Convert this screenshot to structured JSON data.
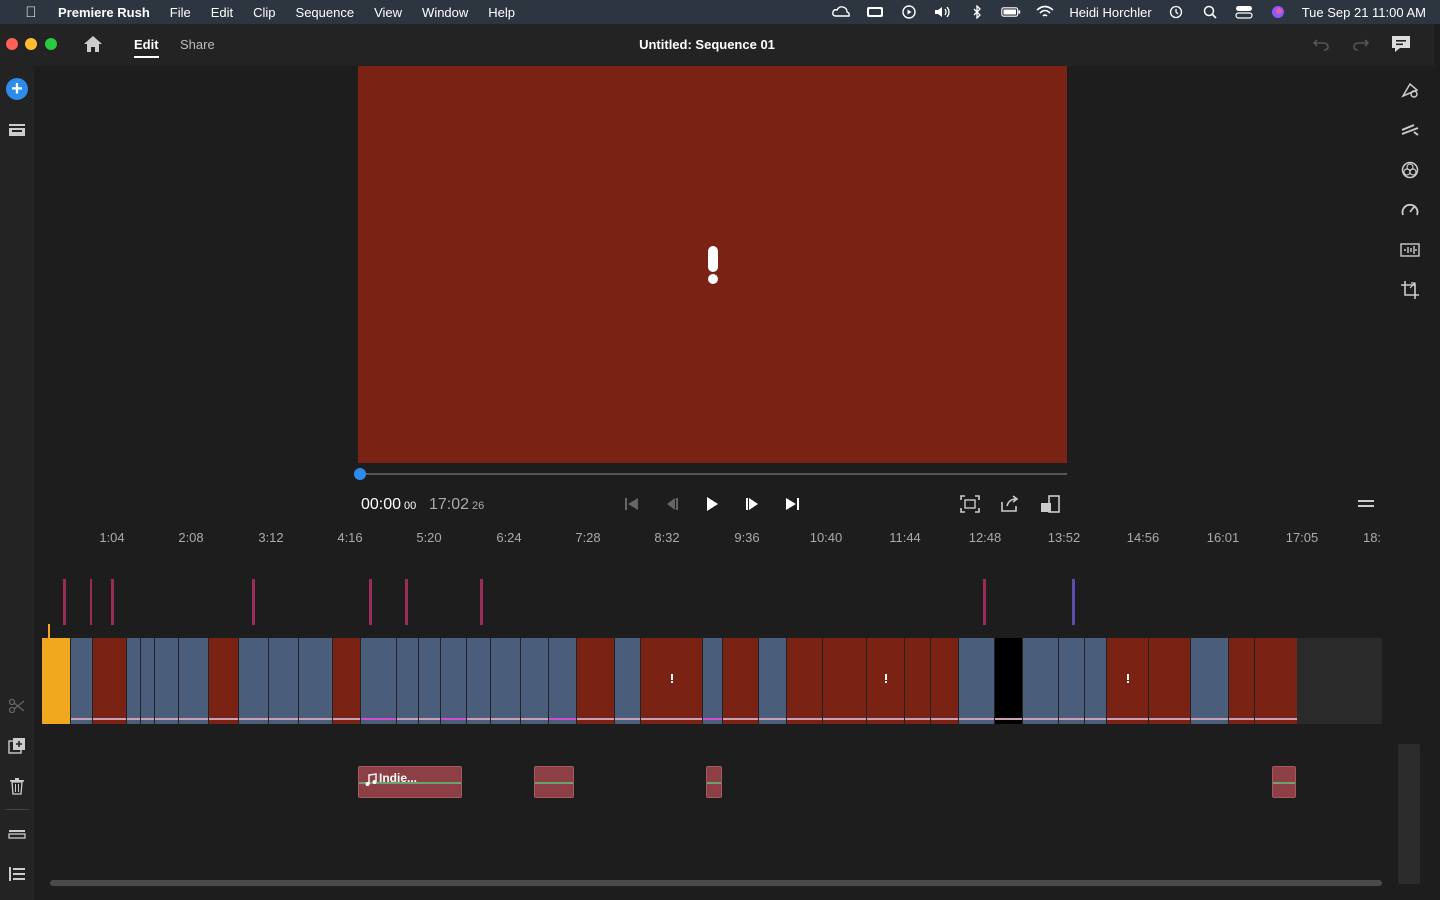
{
  "menubar": {
    "app_name": "Premiere Rush",
    "menus": [
      "File",
      "Edit",
      "Clip",
      "Sequence",
      "View",
      "Window",
      "Help"
    ],
    "user_name": "Heidi Horchler",
    "datetime": "Tue Sep 21  11:00 AM"
  },
  "titlebar": {
    "tab_edit": "Edit",
    "tab_share": "Share",
    "title": "Untitled: Sequence 01"
  },
  "transport": {
    "current_time": "00:00",
    "current_frames": "00",
    "duration_time": "17:02",
    "duration_frames": "26"
  },
  "timeline": {
    "ticks": [
      "1:04",
      "2:08",
      "3:12",
      "4:16",
      "5:20",
      "6:24",
      "7:28",
      "8:32",
      "9:36",
      "10:40",
      "11:44",
      "12:48",
      "13:52",
      "14:56",
      "16:01",
      "17:05",
      "18:"
    ],
    "audio_clip_label": "Indie..."
  },
  "colors": {
    "accent": "#2d8ceb",
    "playhead": "#f2a81e",
    "clip_red": "#7a2213",
    "clip_blue": "#4a5d7a",
    "marker": "#9b2c5a",
    "audio_clip": "#8c4046"
  }
}
